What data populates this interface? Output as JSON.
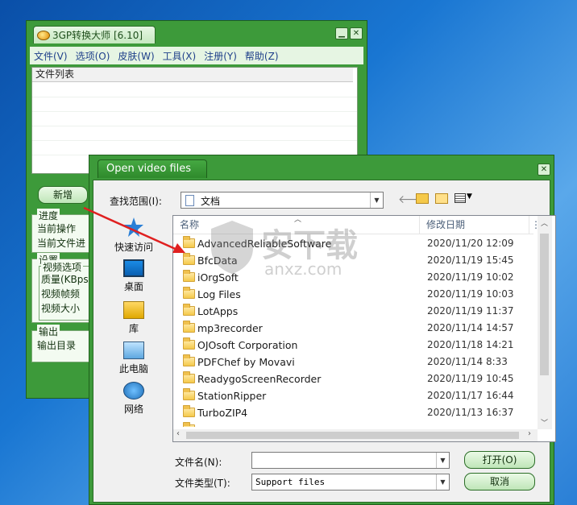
{
  "main_window": {
    "title": "3GP转换大师 [6.10]",
    "menu": [
      "文件(V)",
      "选项(O)",
      "皮肤(W)",
      "工具(X)",
      "注册(Y)",
      "帮助(Z)"
    ],
    "file_list_header": "文件列表",
    "add_button": "新增",
    "progress": {
      "title": "进度",
      "rows": [
        "当前操作",
        "当前文件进"
      ]
    },
    "settings": {
      "title": "设置",
      "video_options": "视频选项",
      "rows": [
        "质量(KBps)",
        "视频帧频",
        "视频大小"
      ]
    },
    "output": {
      "title": "输出",
      "rows": [
        "输出目录"
      ]
    }
  },
  "dialog": {
    "title": "Open video files",
    "look_in_label": "查找范围(I):",
    "look_in_value": "文档",
    "places": [
      {
        "label": "快速访问",
        "icon": "star-icon"
      },
      {
        "label": "桌面",
        "icon": "desktop-icon"
      },
      {
        "label": "库",
        "icon": "library-icon"
      },
      {
        "label": "此电脑",
        "icon": "computer-icon"
      },
      {
        "label": "网络",
        "icon": "network-icon"
      }
    ],
    "columns": {
      "name": "名称",
      "date": "修改日期",
      "extra": "⋮"
    },
    "files": [
      {
        "name": "AdvancedReliableSoftware",
        "date": "2020/11/20 12:09"
      },
      {
        "name": "BfcData",
        "date": "2020/11/19 15:45"
      },
      {
        "name": "iOrgSoft",
        "date": "2020/11/19 10:02"
      },
      {
        "name": "Log Files",
        "date": "2020/11/19 10:03"
      },
      {
        "name": "LotApps",
        "date": "2020/11/19 11:37"
      },
      {
        "name": "mp3recorder",
        "date": "2020/11/14 14:57"
      },
      {
        "name": "OJOsoft Corporation",
        "date": "2020/11/18 14:21"
      },
      {
        "name": "PDFChef by Movavi",
        "date": "2020/11/14 8:33"
      },
      {
        "name": "ReadygoScreenRecorder",
        "date": "2020/11/19 10:45"
      },
      {
        "name": "StationRipper",
        "date": "2020/11/17 16:44"
      },
      {
        "name": "TurboZIP4",
        "date": "2020/11/13 16:37"
      }
    ],
    "filename_label": "文件名(N):",
    "filename_value": "",
    "filetype_label": "文件类型(T):",
    "filetype_value": "Support files",
    "open_button": "打开(O)",
    "cancel_button": "取消"
  },
  "watermark": {
    "text": "安下载",
    "sub": "anxz.com"
  },
  "colors": {
    "skin_green": "#3d9a3a",
    "arrow_red": "#e02020"
  }
}
